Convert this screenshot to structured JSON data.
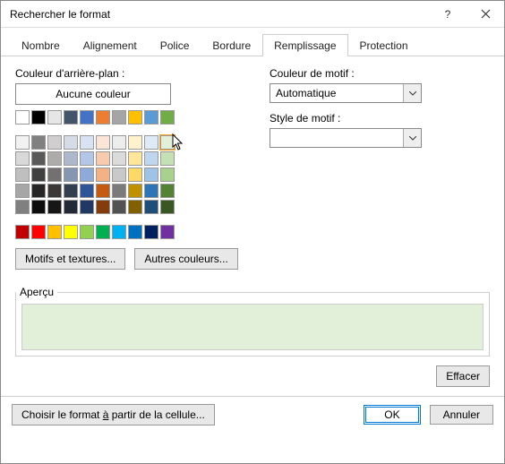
{
  "window": {
    "title": "Rechercher le format"
  },
  "tabs": {
    "nombre": "Nombre",
    "alignement": "Alignement",
    "police": "Police",
    "bordure": "Bordure",
    "remplissage": "Remplissage",
    "protection": "Protection"
  },
  "left": {
    "bg_label": "Couleur d'arrière-plan :",
    "no_color": "Aucune couleur",
    "motifs_btn": "Motifs et textures...",
    "autres_btn": "Autres couleurs..."
  },
  "right": {
    "pattern_color_label": "Couleur de motif :",
    "pattern_color_value": "Automatique",
    "pattern_style_label": "Style de motif :",
    "pattern_style_value": ""
  },
  "apercu": {
    "legend": "Aperçu",
    "color": "#e2efd9"
  },
  "effacer": "Effacer",
  "footer": {
    "choose": "Choisir le format à partir de la cellule...",
    "choose_prefix": "Choisir le format ",
    "choose_ul": "à",
    "choose_suffix": " partir de la cellule...",
    "ok": "OK",
    "cancel": "Annuler"
  },
  "palette": {
    "row1": [
      "#ffffff",
      "#000000",
      "#e7e6e6",
      "#44546a",
      "#4472c4",
      "#ed7d31",
      "#a5a5a5",
      "#ffc000",
      "#5b9bd5",
      "#70ad47"
    ],
    "theme": [
      [
        "#f2f2f2",
        "#808080",
        "#d0cece",
        "#d6dce5",
        "#d9e2f3",
        "#fbe5d6",
        "#ededed",
        "#fff2cc",
        "#deebf7",
        "#e2efd9"
      ],
      [
        "#d9d9d9",
        "#595959",
        "#aeabab",
        "#adb9ca",
        "#b4c6e7",
        "#f8cbad",
        "#dbdbdb",
        "#ffe699",
        "#bdd7ee",
        "#c5e0b4"
      ],
      [
        "#bfbfbf",
        "#404040",
        "#757070",
        "#8496b0",
        "#8eaadb",
        "#f4b183",
        "#c9c9c9",
        "#ffd966",
        "#9dc3e6",
        "#a9d18e"
      ],
      [
        "#a6a6a6",
        "#262626",
        "#3b3838",
        "#323f4f",
        "#2f5597",
        "#c55a11",
        "#7b7b7b",
        "#bf9000",
        "#2e75b6",
        "#548235"
      ],
      [
        "#808080",
        "#0d0d0d",
        "#171616",
        "#222a35",
        "#1f3864",
        "#843c0c",
        "#525252",
        "#806000",
        "#1f4e79",
        "#385723"
      ]
    ],
    "standard": [
      "#c00000",
      "#ff0000",
      "#ffc000",
      "#ffff00",
      "#92d050",
      "#00b050",
      "#00b0f0",
      "#0070c0",
      "#002060",
      "#7030a0"
    ]
  }
}
